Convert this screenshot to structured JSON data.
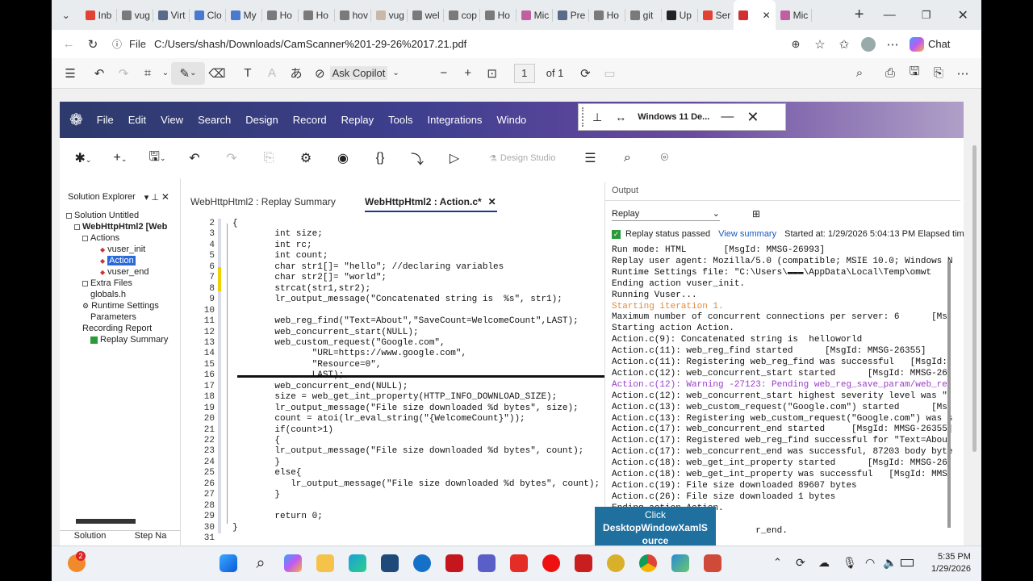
{
  "browser": {
    "tabs": [
      {
        "label": "Inb",
        "color": "#e34133"
      },
      {
        "label": "vug",
        "color": "#7a7a7a"
      },
      {
        "label": "Virt",
        "color": "#5a6a8a"
      },
      {
        "label": "Clo",
        "color": "#4a7ad0"
      },
      {
        "label": "My",
        "color": "#4a7ad0"
      },
      {
        "label": "Ho",
        "color": "#7a7a7a"
      },
      {
        "label": "Ho",
        "color": "#7a7a7a"
      },
      {
        "label": "hov",
        "color": "#7a7a7a"
      },
      {
        "label": "vug",
        "color": "#c9b8a8"
      },
      {
        "label": "wel",
        "color": "#7a7a7a"
      },
      {
        "label": "cop",
        "color": "#7a7a7a"
      },
      {
        "label": "Ho",
        "color": "#7a7a7a"
      },
      {
        "label": "Mic",
        "color": "#c060a0"
      },
      {
        "label": "Pre",
        "color": "#5a6a8a"
      },
      {
        "label": "Ho",
        "color": "#7a7a7a"
      },
      {
        "label": "git",
        "color": "#7a7a7a"
      },
      {
        "label": "Up",
        "color": "#222222"
      },
      {
        "label": "Ser",
        "color": "#e34133"
      },
      {
        "label": "",
        "color": "#d03030"
      },
      {
        "label": "Mic",
        "color": "#c060a0"
      }
    ],
    "address_prefix": "File",
    "address": "C:/Users/shash/Downloads/CamScanner%201-29-26%2017.21.pdf",
    "chat_label": "Chat"
  },
  "pdf_toolbar": {
    "ask_copilot": "Ask Copilot",
    "page_value": "1",
    "page_of": "of 1"
  },
  "vugen": {
    "menu": [
      "File",
      "Edit",
      "View",
      "Search",
      "Design",
      "Record",
      "Replay",
      "Tools",
      "Integrations",
      "Windo"
    ],
    "design_studio": "Design Studio",
    "solution_explorer": {
      "title": "Solution Explorer",
      "items": [
        "Solution Untitled",
        "WebHttpHtml2 [Web",
        "Actions",
        "vuser_init",
        "Action",
        "vuser_end",
        "Extra Files",
        "globals.h",
        "Runtime Settings",
        "Parameters",
        "Recording Report",
        "Replay Summary"
      ],
      "bottom_tabs": [
        "Solution",
        "Step Na"
      ]
    },
    "editor": {
      "tabs": [
        "WebHttpHtml2 : Replay Summary",
        "WebHttpHtml2 : Action.c*"
      ],
      "lines": [
        {
          "n": "2",
          "t": "{"
        },
        {
          "n": "3",
          "t": "    int size;"
        },
        {
          "n": "4",
          "t": "    int rc;"
        },
        {
          "n": "5",
          "t": "    int count;"
        },
        {
          "n": "6",
          "t": "    char str1[]= \"hello\"; //declaring variables"
        },
        {
          "n": "7",
          "t": "    char str2[]= \"world\";"
        },
        {
          "n": "8",
          "t": "    strcat(str1,str2);"
        },
        {
          "n": "9",
          "t": "    lr_output_message(\"Concatenated string is  %s\", str1);"
        },
        {
          "n": "10",
          "t": ""
        },
        {
          "n": "11",
          "t": "    web_reg_find(\"Text=About\",\"SaveCount=WelcomeCount\",LAST);"
        },
        {
          "n": "12",
          "t": "    web_concurrent_start(NULL);"
        },
        {
          "n": "13",
          "t": "    web_custom_request(\"Google.com\","
        },
        {
          "n": "14",
          "t": "           \"URL=https://www.google.com\","
        },
        {
          "n": "15",
          "t": "           \"Resource=0\","
        },
        {
          "n": "16",
          "t": "           LAST);"
        },
        {
          "n": "17",
          "t": "    web_concurrent_end(NULL);"
        },
        {
          "n": "18",
          "t": "    size = web_get_int_property(HTTP_INFO_DOWNLOAD_SIZE);"
        },
        {
          "n": "19",
          "t": "    lr_output_message(\"File size downloaded %d bytes\", size);"
        },
        {
          "n": "20",
          "t": "    count = atoi(lr_eval_string(\"{WelcomeCount}\"));"
        },
        {
          "n": "21",
          "t": "    if(count>1)"
        },
        {
          "n": "22",
          "t": "    {"
        },
        {
          "n": "23",
          "t": "    lr_output_message(\"File size downloaded %d bytes\", count);"
        },
        {
          "n": "24",
          "t": "    }"
        },
        {
          "n": "25",
          "t": "    else{"
        },
        {
          "n": "26",
          "t": "       lr_output_message(\"File size downloaded %d bytes\", count);"
        },
        {
          "n": "27",
          "t": "    }"
        },
        {
          "n": "28",
          "t": ""
        },
        {
          "n": "29",
          "t": "    return 0;"
        },
        {
          "n": "30",
          "t": "}"
        },
        {
          "n": "31",
          "t": ""
        }
      ]
    },
    "output": {
      "title": "Output",
      "dropdown": "Replay",
      "status": "Replay status passed",
      "view_summary": "View summary",
      "started": "Started at: 1/29/2026 5:04:13 PM  Elapsed time:",
      "lines": [
        "Run mode: HTML       [MsgId: MMSG-26993]",
        "Replay user agent: Mozilla/5.0 (compatible; MSIE 10.0; Windows N",
        "Runtime Settings file: \"C:\\Users\\▬▬▬\\AppData\\Local\\Temp\\omwt",
        "Ending action vuser_init.",
        "Running Vuser...",
        "Starting iteration 1.",
        "Maximum number of concurrent connections per server: 6      [Ms",
        "Starting action Action.",
        "Action.c(9): Concatenated string is  helloworld",
        "Action.c(11): web_reg_find started      [MsgId: MMSG-26355]",
        "Action.c(11): Registering web_reg_find was successful   [MsgId:",
        "Action.c(12): web_concurrent_start started      [MsgId: MMSG-26",
        "Action.c(12): Warning -27123: Pending web_reg_save_param/web_re",
        "Action.c(12): web_concurrent_start highest severity level was \"",
        "Action.c(13): web_custom_request(\"Google.com\") started      [Ms",
        "Action.c(13): Registering web_custom_request(\"Google.com\") was s",
        "Action.c(17): web_concurrent_end started     [MsgId: MMSG-26355]",
        "Action.c(17): Registered web_reg_find successful for \"Text=Abou",
        "Action.c(17): web_concurrent_end was successful, 87203 body byte",
        "Action.c(18): web_get_int_property started      [MsgId: MMSG-26",
        "Action.c(18): web_get_int_property was successful   [MsgId: MMS",
        "Action.c(19): File size downloaded 89607 bytes",
        "Action.c(26): File size downloaded 1 bytes",
        "Ending action Action.",
        "",
        "                           r_end."
      ]
    }
  },
  "floating_window": {
    "title": "Windows 11 De..."
  },
  "tooltip": {
    "line1": "Click",
    "line2": "DesktopWindowXamlS",
    "line3": "ource"
  },
  "taskbar": {
    "time": "5:35 PM",
    "date": "1/29/2026",
    "badge": "2"
  }
}
